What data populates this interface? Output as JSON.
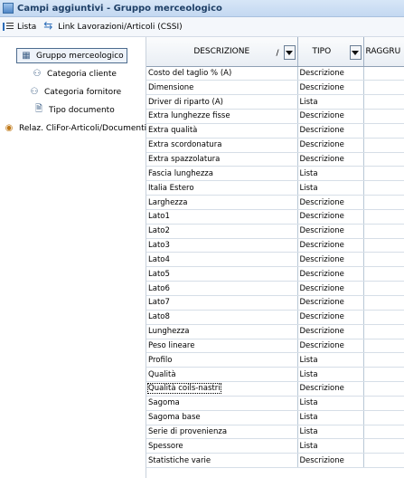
{
  "window": {
    "title": "Campi aggiuntivi - Gruppo merceologico"
  },
  "toolbar": {
    "list_label": "Lista",
    "link_label": "Link Lavorazioni/Articoli (CSSI)"
  },
  "sidebar": {
    "items": [
      {
        "label": "Gruppo merceologico",
        "icon": "group-icon",
        "selected": true
      },
      {
        "label": "Categoria cliente",
        "icon": "customer-category-icon"
      },
      {
        "label": "Categoria fornitore",
        "icon": "supplier-category-icon"
      },
      {
        "label": "Tipo documento",
        "icon": "document-icon"
      },
      {
        "label": "Relaz. CliFor-Articoli/Documenti",
        "icon": "relation-icon"
      }
    ]
  },
  "grid": {
    "columns": {
      "descrizione": "DESCRIZIONE",
      "tipo": "TIPO",
      "raggruppamento": "RAGGRU",
      "sort_mark": "/"
    },
    "rows": [
      {
        "descrizione": "Costo del taglio % (A)",
        "tipo": "Descrizione"
      },
      {
        "descrizione": "Dimensione",
        "tipo": "Descrizione"
      },
      {
        "descrizione": "Driver di riparto (A)",
        "tipo": "Lista"
      },
      {
        "descrizione": "Extra lunghezze fisse",
        "tipo": "Descrizione"
      },
      {
        "descrizione": "Extra qualità",
        "tipo": "Descrizione"
      },
      {
        "descrizione": "Extra scordonatura",
        "tipo": "Descrizione"
      },
      {
        "descrizione": "Extra spazzolatura",
        "tipo": "Descrizione"
      },
      {
        "descrizione": "Fascia lunghezza",
        "tipo": "Lista"
      },
      {
        "descrizione": "Italia Estero",
        "tipo": "Lista"
      },
      {
        "descrizione": "Larghezza",
        "tipo": "Descrizione"
      },
      {
        "descrizione": "Lato1",
        "tipo": "Descrizione"
      },
      {
        "descrizione": "Lato2",
        "tipo": "Descrizione"
      },
      {
        "descrizione": "Lato3",
        "tipo": "Descrizione"
      },
      {
        "descrizione": "Lato4",
        "tipo": "Descrizione"
      },
      {
        "descrizione": "Lato5",
        "tipo": "Descrizione"
      },
      {
        "descrizione": "Lato6",
        "tipo": "Descrizione"
      },
      {
        "descrizione": "Lato7",
        "tipo": "Descrizione"
      },
      {
        "descrizione": "Lato8",
        "tipo": "Descrizione"
      },
      {
        "descrizione": "Lunghezza",
        "tipo": "Descrizione"
      },
      {
        "descrizione": "Peso lineare",
        "tipo": "Descrizione"
      },
      {
        "descrizione": "Profilo",
        "tipo": "Lista"
      },
      {
        "descrizione": "Qualità",
        "tipo": "Lista"
      },
      {
        "descrizione": "Qualità coils-nastri",
        "tipo": "Descrizione",
        "focused": true
      },
      {
        "descrizione": "Sagoma",
        "tipo": "Lista"
      },
      {
        "descrizione": "Sagoma base",
        "tipo": "Lista"
      },
      {
        "descrizione": "Serie di provenienza",
        "tipo": "Lista"
      },
      {
        "descrizione": "Spessore",
        "tipo": "Lista"
      },
      {
        "descrizione": "Statistiche varie",
        "tipo": "Descrizione"
      }
    ]
  }
}
